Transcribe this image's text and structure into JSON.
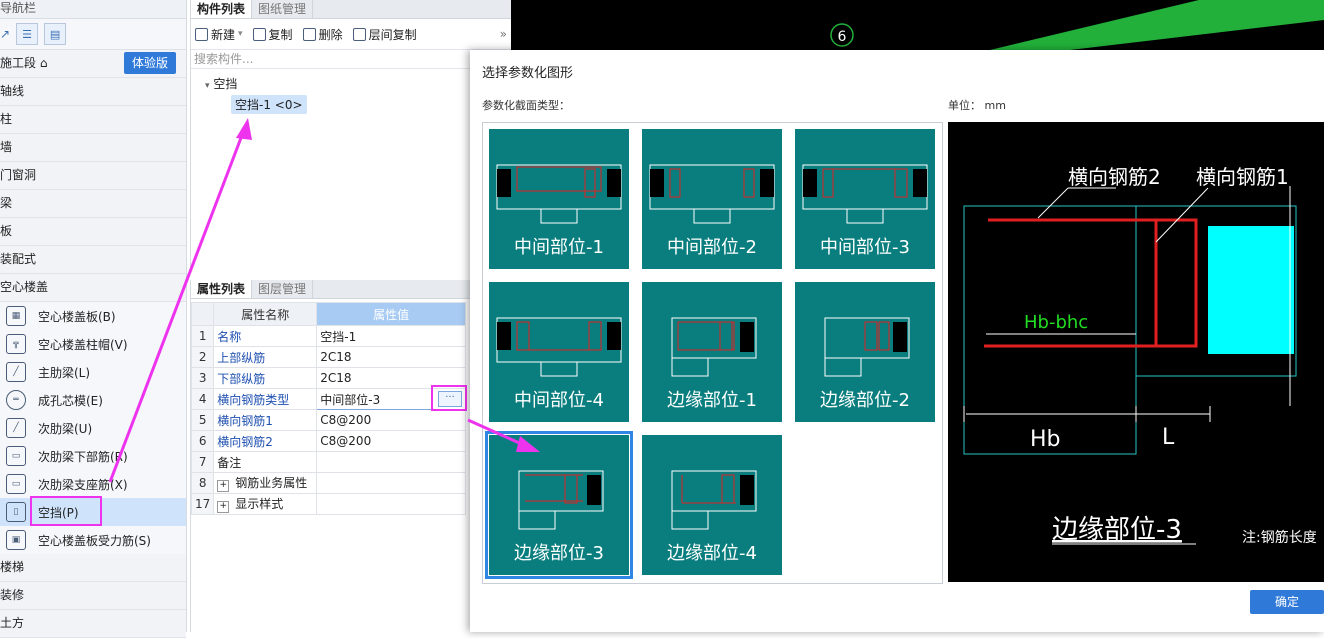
{
  "nav": {
    "header": "导航栏",
    "sections_top": [
      "施工段",
      "轴线",
      "柱",
      "墙",
      "门窗洞",
      "梁",
      "板",
      "装配式",
      "空心楼盖"
    ],
    "trial_label": "体验版",
    "items": [
      {
        "label": "空心楼盖板(B)",
        "icon": "slab-icon"
      },
      {
        "label": "空心楼盖柱帽(V)",
        "icon": "column-cap-icon"
      },
      {
        "label": "主肋梁(L)",
        "icon": "main-rib-icon"
      },
      {
        "label": "成孔芯模(E)",
        "icon": "core-mold-icon"
      },
      {
        "label": "次肋梁(U)",
        "icon": "secondary-rib-icon"
      },
      {
        "label": "次肋梁下部筋(R)",
        "icon": "rib-bottom-bar-icon"
      },
      {
        "label": "次肋梁支座筋(X)",
        "icon": "rib-support-bar-icon"
      },
      {
        "label": "空挡(P)",
        "icon": "gap-icon"
      },
      {
        "label": "空心楼盖板受力筋(S)",
        "icon": "slab-bar-icon"
      }
    ],
    "sections_bottom": [
      "楼梯",
      "装修",
      "土方"
    ]
  },
  "component_panel": {
    "tabs": [
      "构件列表",
      "图纸管理"
    ],
    "toolbar": {
      "new": "新建",
      "copy": "复制",
      "delete": "删除",
      "floor_copy": "层间复制"
    },
    "search_placeholder": "搜索构件...",
    "tree_root": "空挡",
    "tree_node": "空挡-1 <0>"
  },
  "property_panel": {
    "tabs": [
      "属性列表",
      "图层管理"
    ],
    "col_name": "属性名称",
    "col_value": "属性值",
    "rows": [
      {
        "n": "1",
        "name": "名称",
        "value": "空挡-1"
      },
      {
        "n": "2",
        "name": "上部纵筋",
        "value": "2C18"
      },
      {
        "n": "3",
        "name": "下部纵筋",
        "value": "2C18"
      },
      {
        "n": "4",
        "name": "横向钢筋类型",
        "value": "中间部位-3"
      },
      {
        "n": "5",
        "name": "横向钢筋1",
        "value": "C8@200"
      },
      {
        "n": "6",
        "name": "横向钢筋2",
        "value": "C8@200"
      },
      {
        "n": "7",
        "name": "备注",
        "value": ""
      },
      {
        "n": "8",
        "name": "钢筋业务属性",
        "value": ""
      },
      {
        "n": "17",
        "name": "显示样式",
        "value": ""
      }
    ],
    "ellipsis": "···"
  },
  "dialog": {
    "title": "选择参数化图形",
    "section_type_label": "参数化截面类型：",
    "unit_label": "单位： mm",
    "shapes": [
      "中间部位-1",
      "中间部位-2",
      "中间部位-3",
      "中间部位-4",
      "边缘部位-1",
      "边缘部位-2",
      "边缘部位-3",
      "边缘部位-4"
    ],
    "selected_shape": "边缘部位-3",
    "preview": {
      "label_bar2": "横向钢筋2",
      "label_bar1": "横向钢筋1",
      "label_hb_bhc": "Hb-bhc",
      "label_hb": "Hb",
      "label_l": "L",
      "title": "边缘部位-3",
      "note": "注:钢筋长度"
    },
    "ok_label": "确定"
  },
  "cad": {
    "axis_label": "6"
  },
  "colors": {
    "accent": "#2f7ad9",
    "tile": "#0a7e7e",
    "highlight": "#ee33ee",
    "rebar": "#e02020",
    "concrete_cyan": "#00ffff"
  }
}
